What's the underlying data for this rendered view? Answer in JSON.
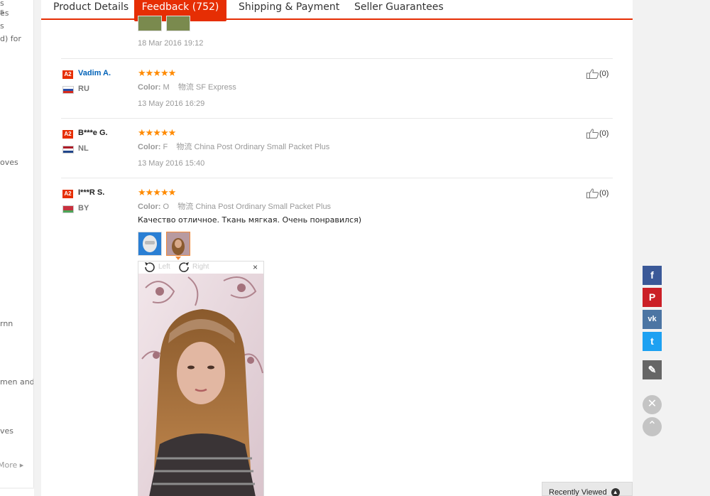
{
  "sidebar": {
    "fragments": [
      "s",
      "es",
      "s",
      "d) for",
      "oves",
      "rnn",
      "men and",
      "ves"
    ],
    "more_label": "More ▸"
  },
  "tabs": [
    {
      "label": "Product Details"
    },
    {
      "label": "Feedback (752)"
    },
    {
      "label": "Shipping & Payment"
    },
    {
      "label": "Seller Guarantees"
    }
  ],
  "previous_review": {
    "date": "18 Mar 2016 19:12"
  },
  "reviews": [
    {
      "badge": "A2",
      "name": "Vadim A.",
      "country": "RU",
      "stars": "★★★★★",
      "color_label": "Color:",
      "color_value": "M",
      "logistics_label": "物流",
      "logistics_value": "SF Express",
      "date": "13 May 2016 16:29",
      "helpful_count": "(0)"
    },
    {
      "badge": "A2",
      "name": "B***e G.",
      "country": "NL",
      "stars": "★★★★★",
      "color_label": "Color:",
      "color_value": "F",
      "logistics_label": "物流",
      "logistics_value": "China Post Ordinary Small Packet Plus",
      "date": "13 May 2016 15:40",
      "helpful_count": "(0)"
    },
    {
      "badge": "A2",
      "name": "I***R S.",
      "country": "BY",
      "stars": "★★★★★",
      "color_label": "Color:",
      "color_value": "O",
      "logistics_label": "物流",
      "logistics_value": "China Post Ordinary Small Packet Plus",
      "comment": "Качество отличное. Ткань мягкая. Очень понравился)",
      "helpful_count": "(0)"
    }
  ],
  "image_viewer": {
    "rotate_left": "Left",
    "rotate_right": "Right",
    "close": "×"
  },
  "share": {
    "facebook": "f",
    "pinterest": "P",
    "vk": "vk",
    "twitter": "t",
    "edit": "✎",
    "close": "✕",
    "top": "⌃"
  },
  "recently_viewed": {
    "label": "Recently Viewed"
  },
  "colors": {
    "accent": "#e62e04",
    "star": "#ff8a00",
    "facebook": "#3b5998",
    "pinterest": "#cb2027",
    "vk": "#4c75a3",
    "twitter": "#1da1f2",
    "edit": "#666666",
    "link": "#0062b8"
  }
}
